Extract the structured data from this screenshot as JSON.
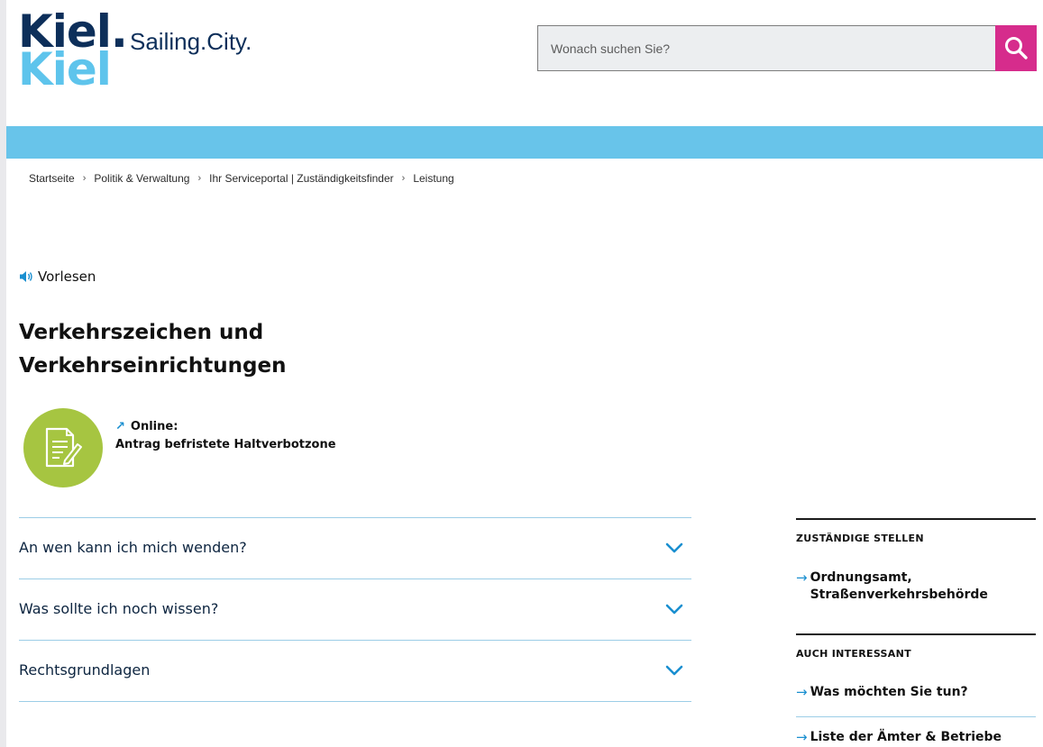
{
  "header": {
    "logo_main": "Kiel.",
    "logo_sub": "Kiel",
    "logo_tagline": "Sailing.City.",
    "search_placeholder": "Wonach suchen Sie?"
  },
  "breadcrumb": [
    "Startseite",
    "Politik & Verwaltung",
    "Ihr Serviceportal | Zuständigkeitsfinder",
    "Leistung"
  ],
  "vorlesen_label": "Vorlesen",
  "page_title": "Verkehrszeichen und Verkehrseinrichtungen",
  "online": {
    "label": "Online:",
    "link_text": "Antrag befristete Haltverbotzone"
  },
  "accordion": [
    {
      "label": "An wen kann ich mich wenden?"
    },
    {
      "label": "Was sollte ich noch wissen?"
    },
    {
      "label": "Rechtsgrundlagen"
    }
  ],
  "sidebar": {
    "zustaendig": {
      "heading": "ZUSTÄNDIGE STELLEN",
      "links": [
        "Ordnungsamt, Straßenverkehrsbehörde"
      ]
    },
    "interessant": {
      "heading": "AUCH INTERESSANT",
      "links": [
        "Was möchten Sie tun?",
        "Liste der Ämter & Betriebe"
      ]
    }
  },
  "colors": {
    "brand_navy": "#0d2f5a",
    "brand_light_blue": "#68c4ea",
    "search_button": "#d62c8c",
    "document_icon_bg": "#a6c541",
    "link_arrow": "#1a8fd0"
  },
  "icons": {
    "search": "search-icon",
    "speaker": "speaker-icon",
    "external_link": "arrow-northeast-icon",
    "document": "document-edit-icon",
    "accordion_toggle": "chevron-down-icon",
    "link_arrow": "arrow-right-icon"
  }
}
